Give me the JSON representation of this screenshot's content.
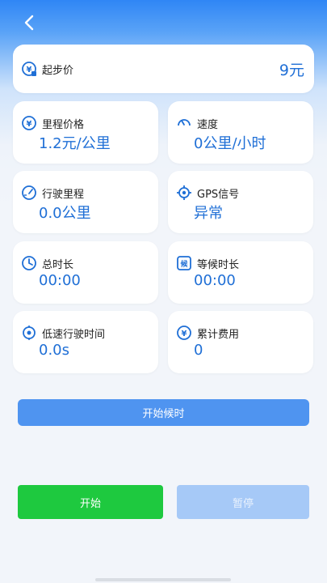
{
  "header": {
    "back_icon": "back-arrow-icon"
  },
  "start_fare": {
    "label": "起步价",
    "value": "9元",
    "icon": "yuan-icon"
  },
  "stats": [
    {
      "key": "mileage_price",
      "label": "里程价格",
      "value": "1.2元/公里",
      "icon": "yuan-icon"
    },
    {
      "key": "speed",
      "label": "速度",
      "value": "0公里/小时",
      "icon": "speedometer-icon"
    },
    {
      "key": "distance",
      "label": "行驶里程",
      "value": "0.0公里",
      "icon": "odometer-icon"
    },
    {
      "key": "gps",
      "label": "GPS信号",
      "value": "异常",
      "icon": "gps-target-icon"
    },
    {
      "key": "total_time",
      "label": "总时长",
      "value": "00:00",
      "icon": "clock-icon"
    },
    {
      "key": "wait_time",
      "label": "等候时长",
      "value": "00:00",
      "icon": "wait-badge-icon"
    },
    {
      "key": "low_speed_time",
      "label": "低速行驶时间",
      "value": "0.0s",
      "icon": "target-icon"
    },
    {
      "key": "total_fee",
      "label": "累计费用",
      "value": "0",
      "icon": "yuan-icon"
    }
  ],
  "buttons": {
    "start_wait": "开始候时",
    "start": "开始",
    "pause": "暂停"
  },
  "colors": {
    "accent": "#1f6fd6",
    "header_blue": "#2f86f5",
    "start_green": "#1ec93f",
    "pause_disabled": "#a6c9f7",
    "wait_button": "#4f94f0"
  }
}
